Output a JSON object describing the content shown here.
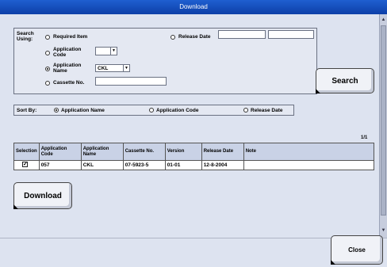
{
  "window": {
    "title": "Download"
  },
  "search": {
    "label": "Search Using:",
    "options": [
      {
        "label": "Required Item"
      },
      {
        "label": "Application Code"
      },
      {
        "label": "Application Name",
        "selected": true
      },
      {
        "label": "Cassette No."
      },
      {
        "label": "Release Date"
      }
    ],
    "application_name_value": "CKL",
    "button_label": "Search"
  },
  "sort": {
    "label": "Sort By:",
    "options": [
      {
        "label": "Application Name",
        "selected": true
      },
      {
        "label": "Application Code"
      },
      {
        "label": "Release Date"
      }
    ]
  },
  "results": {
    "page_indicator": "1/1",
    "columns": [
      "Selection",
      "Application Code",
      "Application Name",
      "Cassette No.",
      "Version",
      "Release Date",
      "Note"
    ],
    "rows": [
      {
        "selected": true,
        "code": "057",
        "name": "CKL",
        "cassette": "07-5923-5",
        "version": "01-01",
        "release_date": "12-8-2004",
        "note": ""
      }
    ]
  },
  "actions": {
    "download_label": "Download",
    "close_label": "Close"
  }
}
